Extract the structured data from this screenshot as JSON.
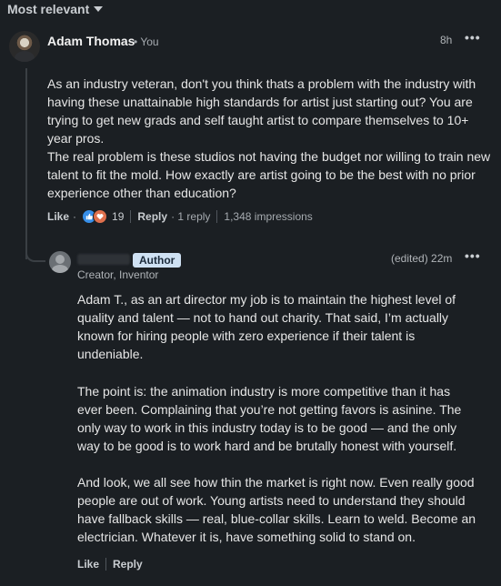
{
  "sort": {
    "label": "Most relevant"
  },
  "comment": {
    "author": "Adam Thomas",
    "badge": "• You",
    "time": "8h",
    "more": "•••",
    "paragraphs": [
      "As an industry veteran, don't you think thats a problem with the industry with having these unattainable high standards for artist just starting out? You are trying to get new grads and self taught artist to compare themselves to 10+ year pros.",
      "The real problem is these studios not having the budget nor willing to train new talent to fit the mold. How exactly are artist going to be the best with no prior experience other than education?"
    ],
    "actions": {
      "like": "Like",
      "dot": "·",
      "reaction_count": "19",
      "reply": "Reply",
      "reply_count": "· 1 reply",
      "impressions": "1,348 impressions"
    }
  },
  "reply": {
    "author_badge": "Author",
    "headline": "Creator, Inventor",
    "time": "(edited) 22m",
    "more": "•••",
    "paragraphs": [
      "Adam T., as an art director my job is to maintain the highest level of quality and talent — not to hand out charity. That said, I’m actually known for hiring people with zero experience if their talent is undeniable.",
      "The point is: the animation industry is more competitive than it has ever been. Complaining that you’re not getting favors is asinine. The only way to work in this industry today is to be good — and the only way to be good is to work hard and be brutally honest with yourself.",
      "And look, we all see how thin the market is right now. Even really good people are out of work. Young artists need to understand they should have fallback skills — real, blue-collar skills. Learn to weld. Become an electrician. Whatever it is, have something solid to stand on."
    ],
    "actions": {
      "like": "Like",
      "reply": "Reply"
    }
  },
  "colors": {
    "background": "#1b1f23",
    "author_badge_bg": "#cfe1f3",
    "like_reaction": "#378fe9",
    "love_reaction": "#df704d"
  },
  "icons": {
    "like": "thumbs-up-icon",
    "love": "heart-icon",
    "sort": "chevron-down-icon"
  }
}
